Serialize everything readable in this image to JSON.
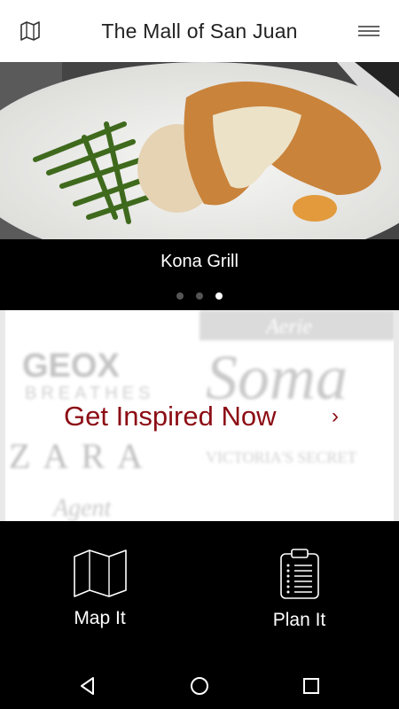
{
  "header": {
    "title": "The Mall of San Juan",
    "map_icon": "folded-map-icon",
    "menu_icon": "hamburger-menu-icon"
  },
  "carousel": {
    "caption": "Kona Grill",
    "slide_count": 3,
    "active_index": 2
  },
  "inspire": {
    "cta_label": "Get Inspired Now",
    "chevron": "›",
    "background_logos": [
      "GEOX",
      "BREATHES",
      "ZARA",
      "Soma",
      "VICTORIA'S SECRET",
      "Aerie",
      "Agent"
    ]
  },
  "actions": [
    {
      "label": "Map It",
      "icon": "folded-map-icon"
    },
    {
      "label": "Plan It",
      "icon": "clipboard-list-icon"
    }
  ],
  "system_nav": {
    "back_icon": "back-triangle-icon",
    "home_icon": "home-circle-icon",
    "recents_icon": "recents-square-icon"
  },
  "colors": {
    "accent": "#8c0d14",
    "bar": "#000000",
    "background": "#ffffff"
  }
}
